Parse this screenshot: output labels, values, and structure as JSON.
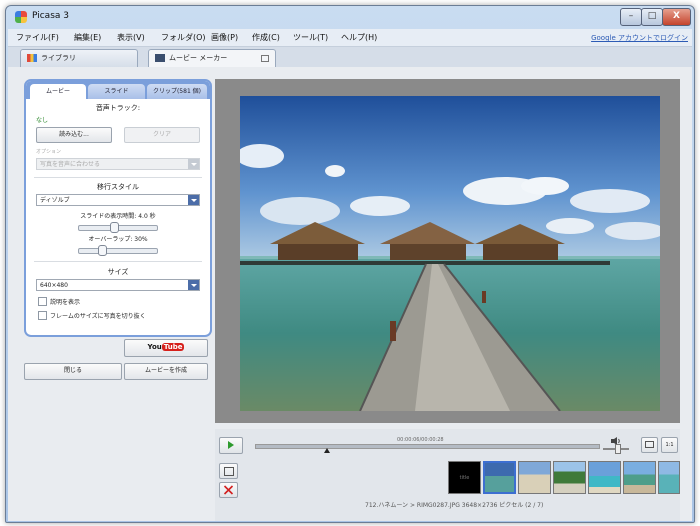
{
  "window": {
    "title": "Picasa 3",
    "min_label": "–",
    "max_label": "□",
    "close_label": "X"
  },
  "menu": {
    "items": [
      "ファイル(F)",
      "編集(E)",
      "表示(V)",
      "フォルダ(O)",
      "画像(P)",
      "作成(C)",
      "ツール(T)",
      "ヘルプ(H)"
    ],
    "google_account": "Google アカウントでログイン"
  },
  "tabs": {
    "library": "ライブラリ",
    "movie_maker": "ムービー メーカー"
  },
  "panel": {
    "tabs": [
      "ムービー",
      "スライド",
      "クリップ(581 個)"
    ],
    "audio_track_heading": "音声トラック:",
    "audio_none": "なし",
    "load_button": "読み込む...",
    "clear_button": "クリア",
    "options_label": "オプション",
    "options_select": "写真を音声に合わせる",
    "transition_heading": "移行スタイル",
    "transition_select": "ディゾルブ",
    "slide_duration_label": "スライドの表示時間: 4.0 秒",
    "slide_duration_value": 0.45,
    "overlap_label": "オーバーラップ: 30%",
    "overlap_value": 0.3,
    "size_heading": "サイズ",
    "size_select": "640×480",
    "show_caption": "説明を表示",
    "crop_to_frame": "フレームのサイズに写真を切り抜く",
    "show_caption_checked": false,
    "crop_checked": false
  },
  "actions": {
    "youtube_you": "You",
    "youtube_tube": "Tube",
    "close_button": "閉じる",
    "create_movie_button": "ムービーを作成"
  },
  "player": {
    "timecode": "00:00:06/00:00:28",
    "progress": 0.21,
    "volume": 0.5,
    "fit_label": "",
    "actual_size_label": "1:1"
  },
  "filmstrip": {
    "title_thumb_text": "title",
    "selected_index": 1
  },
  "status": "712.ハネムーン > RIMG0287.JPG    3648×2736 ピクセル    (2 / 7)",
  "colors": {
    "accent": "#7b9fdb",
    "dropdown": "#4c6da8",
    "youtube_red": "#d6201b",
    "play_green": "#2e9a2e",
    "delete_red": "#d21f1f"
  }
}
